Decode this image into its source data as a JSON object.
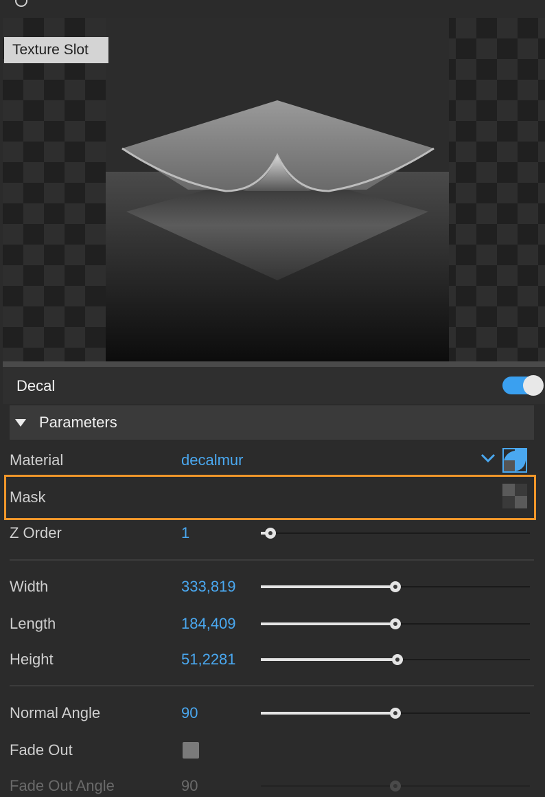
{
  "preview": {
    "texture_slot_label": "Texture Slot"
  },
  "decal": {
    "title": "Decal",
    "enabled": true
  },
  "parameters": {
    "header": "Parameters",
    "material": {
      "label": "Material",
      "value": "decalmur"
    },
    "mask": {
      "label": "Mask"
    },
    "z_order": {
      "label": "Z Order",
      "value": "1",
      "fraction": 0.035
    },
    "width": {
      "label": "Width",
      "value": "333,819",
      "fraction": 0.5
    },
    "length": {
      "label": "Length",
      "value": "184,409",
      "fraction": 0.5
    },
    "height": {
      "label": "Height",
      "value": "51,2281",
      "fraction": 0.507
    },
    "normal_angle": {
      "label": "Normal Angle",
      "value": "90",
      "fraction": 0.5
    },
    "fade_out": {
      "label": "Fade Out",
      "checked": false
    },
    "fade_out_angle": {
      "label": "Fade Out Angle",
      "value": "90",
      "fraction": 0.5,
      "disabled": true
    }
  },
  "colors": {
    "accent": "#4aa8f0",
    "highlight": "#f0962a",
    "toggle_on": "#3aa0f0"
  },
  "icons": [
    "chevron-down-icon",
    "material-thumbnail-icon",
    "mask-thumbnail-icon",
    "collapse-caret-icon"
  ]
}
